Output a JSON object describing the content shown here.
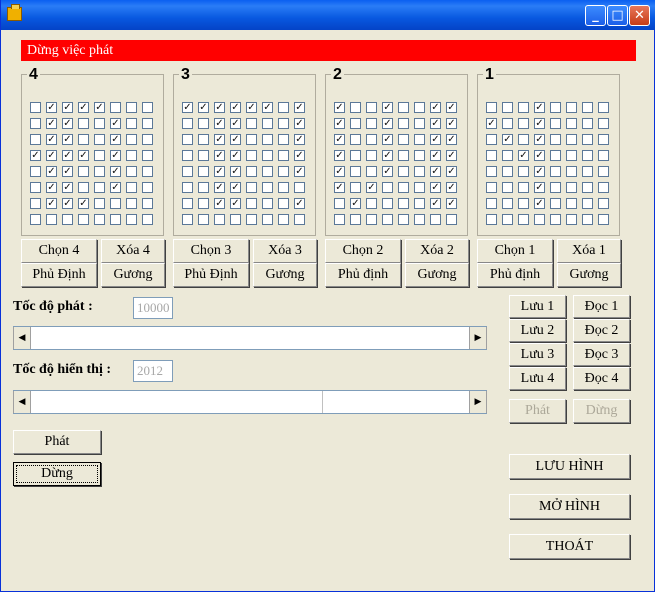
{
  "window": {
    "controls": {
      "minimize": "_",
      "maximize": "□",
      "close": "✕"
    }
  },
  "status_text": "Dừng việc phát",
  "groups": [
    {
      "label": "4",
      "rows": [
        [
          0,
          1,
          1,
          1,
          1,
          0,
          0,
          0
        ],
        [
          0,
          1,
          1,
          0,
          0,
          1,
          0,
          0
        ],
        [
          0,
          1,
          1,
          0,
          0,
          1,
          0,
          0
        ],
        [
          1,
          1,
          1,
          1,
          0,
          1,
          0,
          0
        ],
        [
          0,
          1,
          1,
          0,
          0,
          1,
          0,
          0
        ],
        [
          0,
          1,
          1,
          0,
          0,
          1,
          0,
          0
        ],
        [
          0,
          1,
          1,
          1,
          0,
          0,
          0,
          0
        ],
        [
          0,
          0,
          0,
          0,
          0,
          0,
          0,
          0
        ]
      ],
      "select": "Chọn 4",
      "clear": "Xóa 4",
      "negate": "Phủ Định",
      "mirror": "Gương"
    },
    {
      "label": "3",
      "rows": [
        [
          1,
          1,
          1,
          1,
          1,
          1,
          0,
          1
        ],
        [
          0,
          0,
          1,
          1,
          0,
          0,
          0,
          1
        ],
        [
          0,
          0,
          1,
          1,
          0,
          0,
          0,
          1
        ],
        [
          0,
          0,
          1,
          1,
          0,
          0,
          0,
          1
        ],
        [
          0,
          0,
          1,
          1,
          0,
          0,
          0,
          1
        ],
        [
          0,
          0,
          1,
          1,
          0,
          0,
          0,
          0
        ],
        [
          0,
          0,
          1,
          1,
          0,
          0,
          0,
          1
        ],
        [
          0,
          0,
          0,
          0,
          0,
          0,
          0,
          0
        ]
      ],
      "select": "Chọn 3",
      "clear": "Xóa 3",
      "negate": "Phủ Định",
      "mirror": "Gương"
    },
    {
      "label": "2",
      "rows": [
        [
          1,
          0,
          0,
          1,
          0,
          0,
          1,
          1
        ],
        [
          1,
          0,
          0,
          1,
          0,
          0,
          1,
          1
        ],
        [
          1,
          0,
          0,
          1,
          0,
          0,
          1,
          1
        ],
        [
          1,
          0,
          0,
          1,
          0,
          0,
          1,
          1
        ],
        [
          1,
          0,
          0,
          1,
          0,
          0,
          1,
          1
        ],
        [
          1,
          0,
          1,
          0,
          0,
          0,
          1,
          1
        ],
        [
          0,
          1,
          0,
          0,
          0,
          0,
          1,
          1
        ],
        [
          0,
          0,
          0,
          0,
          0,
          0,
          0,
          0
        ]
      ],
      "select": "Chọn 2",
      "clear": "Xóa 2",
      "negate": "Phủ định",
      "mirror": "Gương"
    },
    {
      "label": "1",
      "rows": [
        [
          0,
          0,
          0,
          1,
          0,
          0,
          0,
          0
        ],
        [
          1,
          0,
          0,
          1,
          0,
          0,
          0,
          0
        ],
        [
          0,
          1,
          0,
          1,
          0,
          0,
          0,
          0
        ],
        [
          0,
          0,
          1,
          1,
          0,
          0,
          0,
          0
        ],
        [
          0,
          0,
          0,
          1,
          0,
          0,
          0,
          0
        ],
        [
          0,
          0,
          0,
          1,
          0,
          0,
          0,
          0
        ],
        [
          0,
          0,
          0,
          1,
          0,
          0,
          0,
          0
        ],
        [
          0,
          0,
          0,
          0,
          0,
          0,
          0,
          0
        ]
      ],
      "select": "Chọn 1",
      "clear": "Xóa 1",
      "negate": "Phủ định",
      "mirror": "Gương"
    }
  ],
  "play_speed": {
    "label": "Tốc độ phát :",
    "value": "10000"
  },
  "display_speed": {
    "label": "Tốc độ hiển thị :",
    "value": "2012"
  },
  "slider": {
    "left_arrow": "◀",
    "right_arrow": "▶",
    "display_level": 0.66
  },
  "play_button": "Phát",
  "stop_button": "Dừng",
  "save_buttons": [
    "Lưu 1",
    "Lưu 2",
    "Lưu 3",
    "Lưu 4"
  ],
  "read_buttons": [
    "Đọc 1",
    "Đọc 2",
    "Đọc 3",
    "Đọc 4"
  ],
  "side_play": "Phát",
  "side_stop": "Dừng",
  "save_image": "LƯU HÌNH",
  "open_image": "MỞ HÌNH",
  "exit": "THOÁT"
}
